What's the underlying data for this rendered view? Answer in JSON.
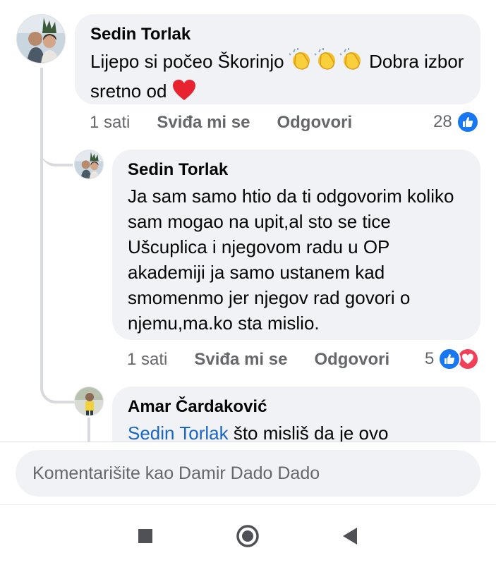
{
  "comments": [
    {
      "author": "Sedin Torlak",
      "text_before": "Lijepo si počeo Škorinjo ",
      "text_after": " Dobra izbor sretno od ",
      "time": "1 sati",
      "like": "Sviđa mi se",
      "reply": "Odgovori",
      "reaction_count": "28"
    },
    {
      "author": "Sedin Torlak",
      "text": "Ja sam samo htio da ti odgovorim koliko sam mogao na upit,al sto se tice Ušcuplica i njegovom radu u OP akademiji ja samo ustanem kad smomenmo jer njegov rad govori o njemu,ma.ko sta mislio.",
      "time": "1 sati",
      "like": "Sviđa mi se",
      "reply": "Odgovori",
      "reaction_count": "5"
    },
    {
      "author": "Amar Čardaković",
      "mention": "Sedin Torlak",
      "text": " što misliš da je ovo"
    }
  ],
  "composer": {
    "placeholder": "Komentarišite kao Damir Dado Dado"
  },
  "colors": {
    "like_blue": "#1877f2",
    "love_red": "#f33e58",
    "mention": "#1a66c6"
  },
  "icons": [
    "clap-emoji",
    "heart-emoji",
    "like-reaction-icon",
    "love-reaction-icon",
    "recents-square-icon",
    "home-circle-icon",
    "back-triangle-icon"
  ]
}
